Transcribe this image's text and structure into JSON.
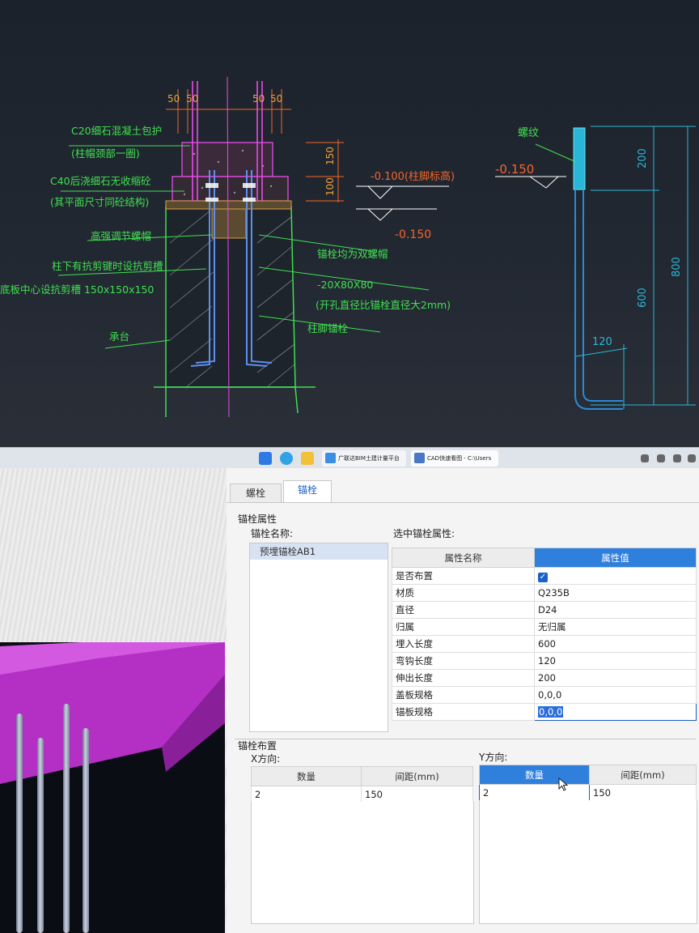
{
  "cad_drawing": {
    "left_detail": {
      "dims_top": [
        "50",
        "50",
        "50",
        "50"
      ],
      "dims_side": [
        "150",
        "100"
      ],
      "elev_labels": [
        "-0.100(柱脚标高)",
        "-0.150"
      ],
      "callouts_left": [
        "C20细石混凝土包护",
        "(柱帽颈部一圈)",
        "C40后浇细石无收缩砼",
        "(其平面尺寸同砼结构)",
        "高强调节螺帽",
        "柱下有抗剪键时设抗剪槽",
        "底板中心设抗剪槽 150x150x150",
        "承台"
      ],
      "callouts_right": [
        "锚栓均为双螺帽",
        "-20X80X80",
        "(开孔直径比锚栓直径大2mm)",
        "柱脚锚栓"
      ]
    },
    "right_detail": {
      "label": "螺纹",
      "elev": "-0.150",
      "dims": [
        "200",
        "600",
        "800",
        "120"
      ]
    }
  },
  "taskbar": {
    "tasks": [
      {
        "label": "广联达BIM土建计量平台",
        "icon": "glodon-app-icon"
      },
      {
        "label": "CAD快速看图 - C:\\Users",
        "icon": "cad-viewer-icon"
      }
    ]
  },
  "dialog": {
    "tabs": [
      "螺栓",
      "锚栓"
    ],
    "active_tab": 1,
    "group_anchor_props": "锚栓属性",
    "name_list_label": "锚栓名称:",
    "name_list": [
      "预埋锚栓AB1"
    ],
    "selected_props_label": "选中锚栓属性:",
    "prop_table": {
      "headers": [
        "属性名称",
        "属性值"
      ],
      "rows": [
        {
          "name": "是否布置",
          "value": "",
          "checked": true
        },
        {
          "name": "材质",
          "value": "Q235B"
        },
        {
          "name": "直径",
          "value": "D24"
        },
        {
          "name": "归属",
          "value": "无归属"
        },
        {
          "name": "埋入长度",
          "value": "600"
        },
        {
          "name": "弯钩长度",
          "value": "120"
        },
        {
          "name": "伸出长度",
          "value": "200"
        },
        {
          "name": "盖板规格",
          "value": "0,0,0"
        },
        {
          "name": "锚板规格",
          "value": "0,0,0"
        }
      ]
    },
    "layout_group": "锚栓布置",
    "x_dir_label": "X方向:",
    "y_dir_label": "Y方向:",
    "x_table": {
      "headers": [
        "数量",
        "间距(mm)"
      ],
      "row": [
        "2",
        "150"
      ]
    },
    "y_table": {
      "headers": [
        "数量",
        "间距(mm)"
      ],
      "row": [
        "2",
        "150"
      ]
    }
  }
}
